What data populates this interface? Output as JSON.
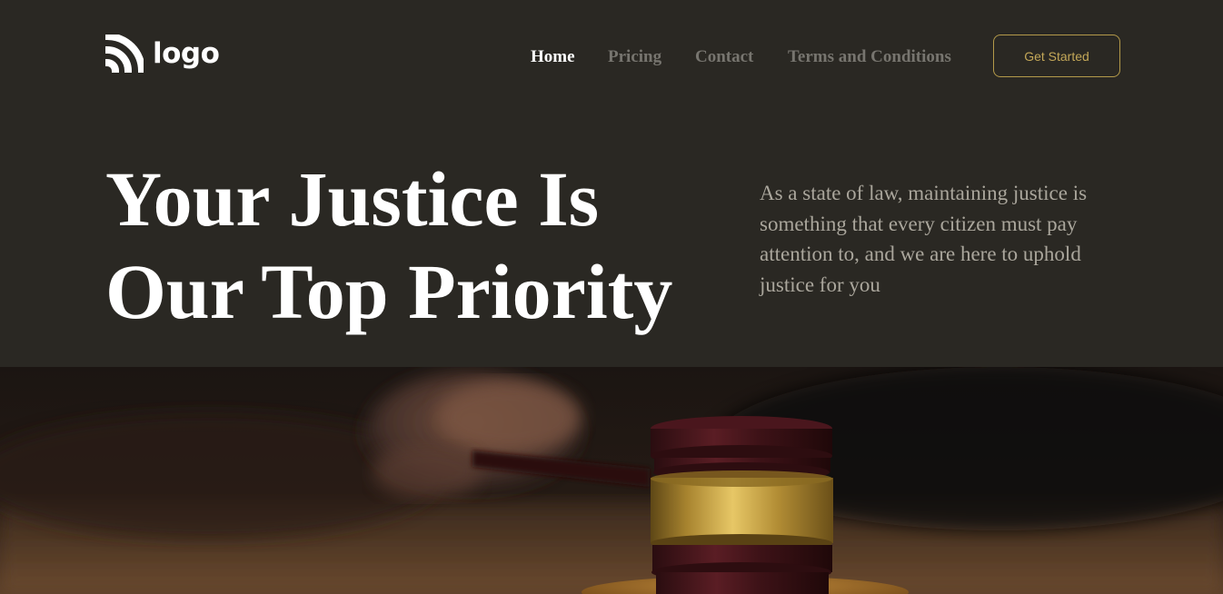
{
  "header": {
    "logo_text": "logo",
    "nav": [
      {
        "label": "Home",
        "active": true
      },
      {
        "label": "Pricing",
        "active": false
      },
      {
        "label": "Contact",
        "active": false
      },
      {
        "label": "Terms and Conditions",
        "active": false
      }
    ],
    "cta_label": "Get Started"
  },
  "hero": {
    "title_line1": "Your Justice Is",
    "title_line2": "Our Top Priority",
    "description": "As a state of law, maintaining justice is something that every citizen must pay attention to, and we are here to uphold justice for you"
  },
  "colors": {
    "background": "#2a2823",
    "accent_gold": "#c3a758",
    "nav_inactive": "#77756f",
    "text_primary": "#ffffff",
    "text_muted": "#aaa69c"
  },
  "icons": {
    "logo": "rss-icon"
  }
}
